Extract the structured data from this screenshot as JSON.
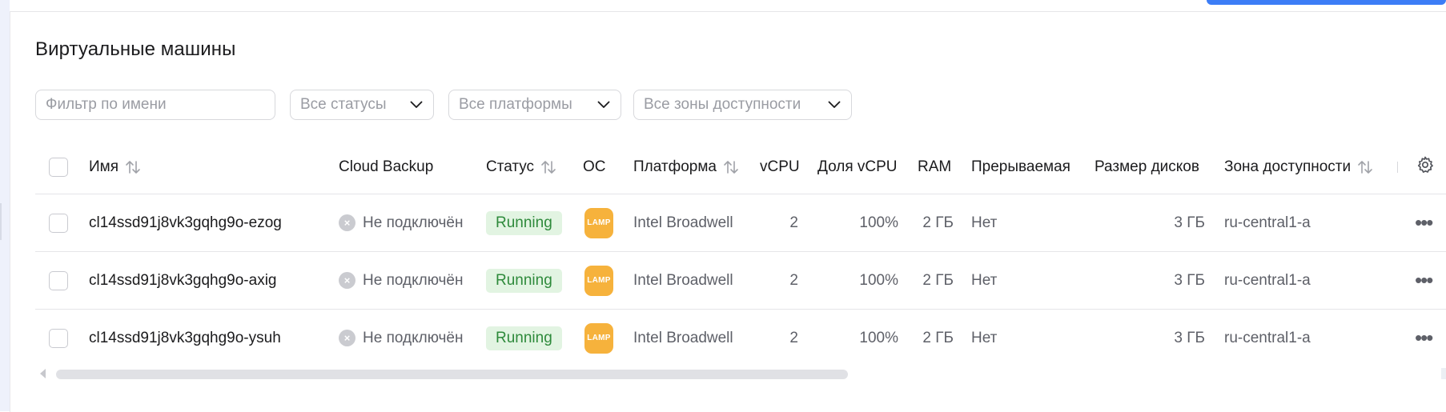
{
  "page": {
    "title": "Виртуальные машины"
  },
  "filters": {
    "name_placeholder": "Фильтр по имени",
    "status": "Все статусы",
    "platform": "Все платформы",
    "zone": "Все зоны доступности"
  },
  "table": {
    "columns": {
      "name": "Имя",
      "backup": "Cloud Backup",
      "status": "Статус",
      "os": "ОС",
      "platform": "Платформа",
      "vcpu": "vCPU",
      "vcpu_share": "Доля vCPU",
      "ram": "RAM",
      "preemptible": "Прерываемая",
      "disk_size": "Размер дисков",
      "zone": "Зона доступности"
    },
    "rows": [
      {
        "name": "cl14ssd91j8vk3gqhg9o-ezog",
        "backup": "Не подключён",
        "status": "Running",
        "os": "LAMP",
        "platform": "Intel Broadwell",
        "vcpu": "2",
        "vcpu_share": "100%",
        "ram": "2 ГБ",
        "preemptible": "Нет",
        "disk_size": "3 ГБ",
        "zone": "ru-central1-a"
      },
      {
        "name": "cl14ssd91j8vk3gqhg9o-axig",
        "backup": "Не подключён",
        "status": "Running",
        "os": "LAMP",
        "platform": "Intel Broadwell",
        "vcpu": "2",
        "vcpu_share": "100%",
        "ram": "2 ГБ",
        "preemptible": "Нет",
        "disk_size": "3 ГБ",
        "zone": "ru-central1-a"
      },
      {
        "name": "cl14ssd91j8vk3gqhg9o-ysuh",
        "backup": "Не подключён",
        "status": "Running",
        "os": "LAMP",
        "platform": "Intel Broadwell",
        "vcpu": "2",
        "vcpu_share": "100%",
        "ram": "2 ГБ",
        "preemptible": "Нет",
        "disk_size": "3 ГБ",
        "zone": "ru-central1-a"
      }
    ]
  },
  "icons": {
    "sort": "sort-arrows-icon",
    "settings": "gear-icon",
    "row_menu": "more-horizontal-icon",
    "backup_status": "cross-circle-icon",
    "select_chevron": "chevron-down-icon"
  },
  "colors": {
    "status_running_bg": "#e2f4e2",
    "status_running_text": "#2e8a3b",
    "lamp_badge": "#f6b23c",
    "accent": "#3c7df6"
  }
}
